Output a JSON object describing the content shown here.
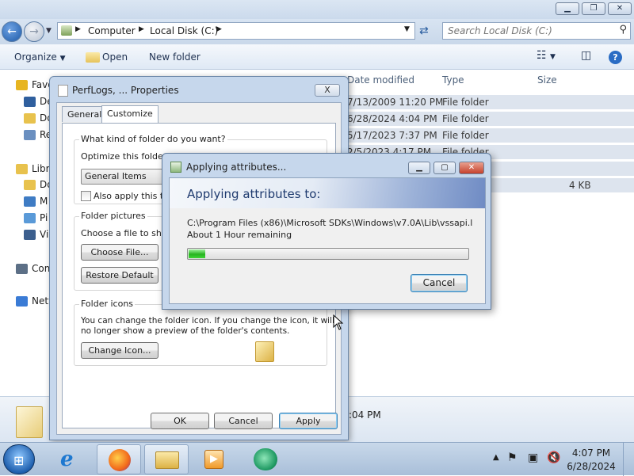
{
  "explorer": {
    "address": {
      "crumbs": [
        "Computer",
        "Local Disk (C:)"
      ]
    },
    "search": {
      "placeholder": "Search Local Disk (C:)"
    },
    "toolbar": {
      "organize": "Organize",
      "open": "Open",
      "new_folder": "New folder"
    },
    "nav": [
      {
        "label": "Favo",
        "icon": "star-icon"
      },
      {
        "label": "De",
        "icon": "desktop-icon"
      },
      {
        "label": "Do",
        "icon": "downloads-icon"
      },
      {
        "label": "Re",
        "icon": "recent-places-icon"
      },
      {
        "label": "Libra",
        "icon": "libraries-icon"
      },
      {
        "label": "Do",
        "icon": "documents-icon"
      },
      {
        "label": "M",
        "icon": "music-icon"
      },
      {
        "label": "Pi",
        "icon": "pictures-icon"
      },
      {
        "label": "Vi",
        "icon": "videos-icon"
      },
      {
        "label": "Com",
        "icon": "computer-icon"
      },
      {
        "label": "Netw",
        "icon": "network-icon"
      }
    ],
    "columns": {
      "date": "Date modified",
      "type": "Type",
      "size": "Size"
    },
    "rows": [
      {
        "date": "7/13/2009 11:20 PM",
        "type": "File folder",
        "size": ""
      },
      {
        "date": "6/28/2024 4:04 PM",
        "type": "File folder",
        "size": ""
      },
      {
        "date": "5/17/2023 7:37 PM",
        "type": "File folder",
        "size": ""
      },
      {
        "date": "2/5/2023 4:17 PM",
        "type": "File folder",
        "size": ""
      },
      {
        "date": "",
        "type": "",
        "size": ""
      },
      {
        "date": "",
        "type": "",
        "size": "4 KB"
      }
    ],
    "details": {
      "date_partial": ":04 PM"
    }
  },
  "properties": {
    "title": "PerfLogs, ... Properties",
    "close": "X",
    "tabs": [
      "General",
      "Customize"
    ],
    "kind_group": "What kind of folder do you want?",
    "optimize_label": "Optimize this folder for:",
    "optimize_value": "General Items",
    "also_apply": "Also apply this tem",
    "pictures_group": "Folder pictures",
    "choose_label": "Choose a file to show",
    "choose_button": "Choose File...",
    "restore_button": "Restore Default",
    "icons_group": "Folder icons",
    "icons_text_1": "You can change the folder icon. If you change the icon, it will",
    "icons_text_2": "no longer show a preview of the folder's contents.",
    "change_icon_button": "Change Icon...",
    "ok": "OK",
    "cancel": "Cancel",
    "apply": "Apply"
  },
  "progress": {
    "title": "Applying attributes...",
    "heading": "Applying attributes to:",
    "path": "C:\\Program Files (x86)\\Microsoft SDKs\\Windows\\v7.0A\\Lib\\vssapi.li",
    "remaining": "About 1 Hour remaining",
    "percent": 3,
    "cancel": "Cancel"
  },
  "taskbar": {
    "time": "4:07 PM",
    "date": "6/28/2024",
    "apps": [
      "internet-explorer-icon",
      "firefox-icon",
      "windows-explorer-icon",
      "media-player-icon",
      "app-icon"
    ]
  },
  "colors": {
    "progress_fill": "#26b31f",
    "title_accent": "#1e3a6e"
  }
}
